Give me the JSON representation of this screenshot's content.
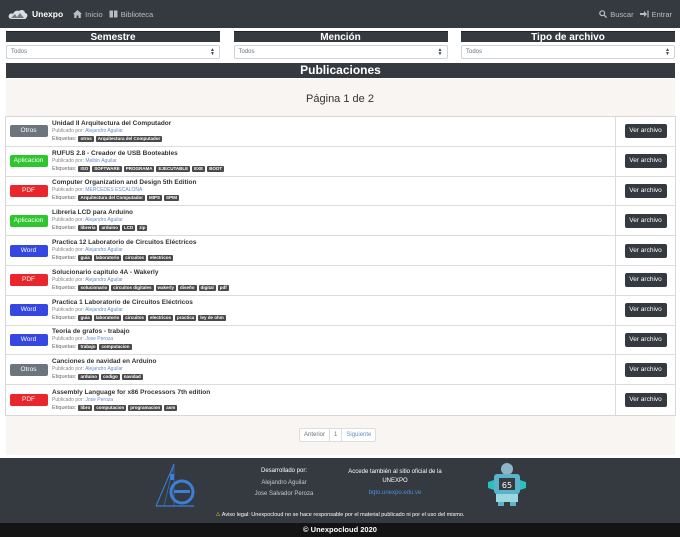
{
  "nav": {
    "brand": "Unexpo",
    "links": [
      {
        "label": "Inicio",
        "icon": "home-icon"
      },
      {
        "label": "Biblioteca",
        "icon": "book-icon"
      }
    ],
    "right_links": [
      {
        "label": "Buscar",
        "icon": "search-icon"
      },
      {
        "label": "Entrar",
        "icon": "sign-in-icon"
      }
    ]
  },
  "filters": [
    {
      "label": "Semestre",
      "selected": "Todos"
    },
    {
      "label": "Mención",
      "selected": "Todos"
    },
    {
      "label": "Tipo de archivo",
      "selected": "Todos"
    }
  ],
  "section_title": "Publicaciones",
  "page_title": "Página 1 de 2",
  "labels": {
    "published_by": "Publicado por:",
    "tags": "Etiquetas:",
    "view": "Ver archivo"
  },
  "type_colors": {
    "Otros": "#6c757d",
    "Aplicacion": "#2fc52f",
    "PDF": "#e8262b",
    "Word": "#3547e0"
  },
  "publications": [
    {
      "type": "Otros",
      "title": "Unidad II Arquitectura del Computador",
      "author": "Alejandro Aguilar",
      "tags": [
        "otros",
        "Arquitectura del Computador"
      ]
    },
    {
      "type": "Aplicacion",
      "title": "RUFUS 2.8 - Creador de USB Booteables",
      "author": "Melbin Aguilar",
      "tags": [
        "ISO",
        "SOFTWARE",
        "PROGRAMA",
        "EJECUTABLE",
        "EXE",
        "BOOT"
      ]
    },
    {
      "type": "PDF",
      "title": "Computer Organization and Design 5th Edition",
      "author": "MERCEDES ESCALONA",
      "tags": [
        "Arquitectura del Computador",
        "MIPS",
        "SPIM"
      ]
    },
    {
      "type": "Aplicacion",
      "title": "Libreria LCD para Arduino",
      "author": "Alejandro Aguilar",
      "tags": [
        "libreria",
        "arduino",
        "LCD",
        "zip"
      ]
    },
    {
      "type": "Word",
      "title": "Practica 12 Laboratorio de Circuitos Eléctricos",
      "author": "Alejandro Aguilar",
      "tags": [
        "guia",
        "laboratorio",
        "circuitos",
        "electricos"
      ]
    },
    {
      "type": "PDF",
      "title": "Solucionario capitulo 4A - Wakerly",
      "author": "Alejandro Aguilar",
      "tags": [
        "solucionario",
        "circuitos digitales",
        "wakerly",
        "diseño",
        "digital",
        "pdf"
      ]
    },
    {
      "type": "Word",
      "title": "Practica 1 Laboratorio de Circuitos Eléctricos",
      "author": "Alejandro Aguilar",
      "tags": [
        "guia",
        "laboratorio",
        "circuitos",
        "electricos",
        "practica",
        "ley de ohm"
      ]
    },
    {
      "type": "Word",
      "title": "Teoria de grafos - trabajo",
      "author": "Jose Peroza",
      "tags": [
        "trabajo",
        "computacion"
      ]
    },
    {
      "type": "Otros",
      "title": "Canciones de navidad en Arduino",
      "author": "Alejandro Aguilar",
      "tags": [
        "arduino",
        "codigo",
        "navidad"
      ]
    },
    {
      "type": "PDF",
      "title": "Assembly Language for x86 Processors 7th edition",
      "author": "Jose Peroza",
      "tags": [
        "libro",
        "computacion",
        "programacion",
        "asm"
      ]
    }
  ],
  "pagination": {
    "prev": "Anterior",
    "current": "1",
    "next": "Siguiente"
  },
  "footer": {
    "dev_title": "Desarrollado por:",
    "devs": [
      "Alejandro Aguilar",
      "Jose Salvador Peroza"
    ],
    "official_line1": "Accede también al sitio oficial de la",
    "official_line2": "UNEXPO",
    "official_link": "bqto.unexpo.edu.ve",
    "legal": "Aviso legal: Unexpocloud no se hace responsable por el material publicado ni por el uso del mismo.",
    "copyright": "© Unexpocloud 2020"
  }
}
